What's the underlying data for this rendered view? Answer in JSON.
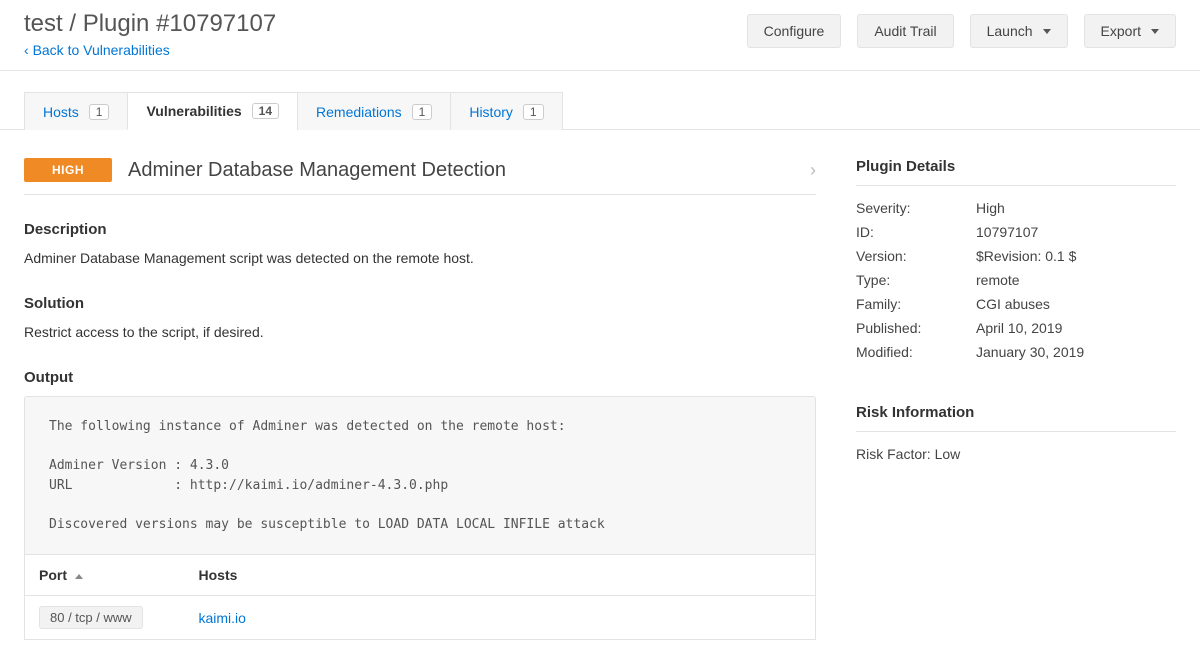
{
  "header": {
    "title": "test / Plugin #10797107",
    "back_link": "Back to Vulnerabilities",
    "buttons": {
      "configure": "Configure",
      "audit": "Audit Trail",
      "launch": "Launch",
      "export": "Export"
    }
  },
  "tabs": {
    "hosts": {
      "label": "Hosts",
      "count": "1"
    },
    "vulnerabilities": {
      "label": "Vulnerabilities",
      "count": "14"
    },
    "remediations": {
      "label": "Remediations",
      "count": "1"
    },
    "history": {
      "label": "History",
      "count": "1"
    }
  },
  "vulnerability": {
    "severity_badge": "HIGH",
    "title": "Adminer Database Management Detection",
    "description_heading": "Description",
    "description": "Adminer Database Management script was detected on the remote host.",
    "solution_heading": "Solution",
    "solution": "Restrict access to the script, if desired.",
    "output_heading": "Output",
    "output_text": "The following instance of Adminer was detected on the remote host:\n\nAdminer Version : 4.3.0\nURL             : http://kaimi.io/adminer-4.3.0.php\n\nDiscovered versions may be susceptible to LOAD DATA LOCAL INFILE attack",
    "output_table": {
      "port_header": "Port",
      "hosts_header": "Hosts",
      "rows": [
        {
          "port": "80 / tcp / www",
          "host": "kaimi.io"
        }
      ]
    }
  },
  "plugin_details": {
    "heading": "Plugin Details",
    "rows": {
      "severity": {
        "label": "Severity:",
        "value": "High"
      },
      "id": {
        "label": "ID:",
        "value": "10797107"
      },
      "version": {
        "label": "Version:",
        "value": "$Revision: 0.1 $"
      },
      "type": {
        "label": "Type:",
        "value": "remote"
      },
      "family": {
        "label": "Family:",
        "value": "CGI abuses"
      },
      "published": {
        "label": "Published:",
        "value": "April 10, 2019"
      },
      "modified": {
        "label": "Modified:",
        "value": "January 30, 2019"
      }
    }
  },
  "risk": {
    "heading": "Risk Information",
    "factor": "Risk Factor: Low"
  }
}
